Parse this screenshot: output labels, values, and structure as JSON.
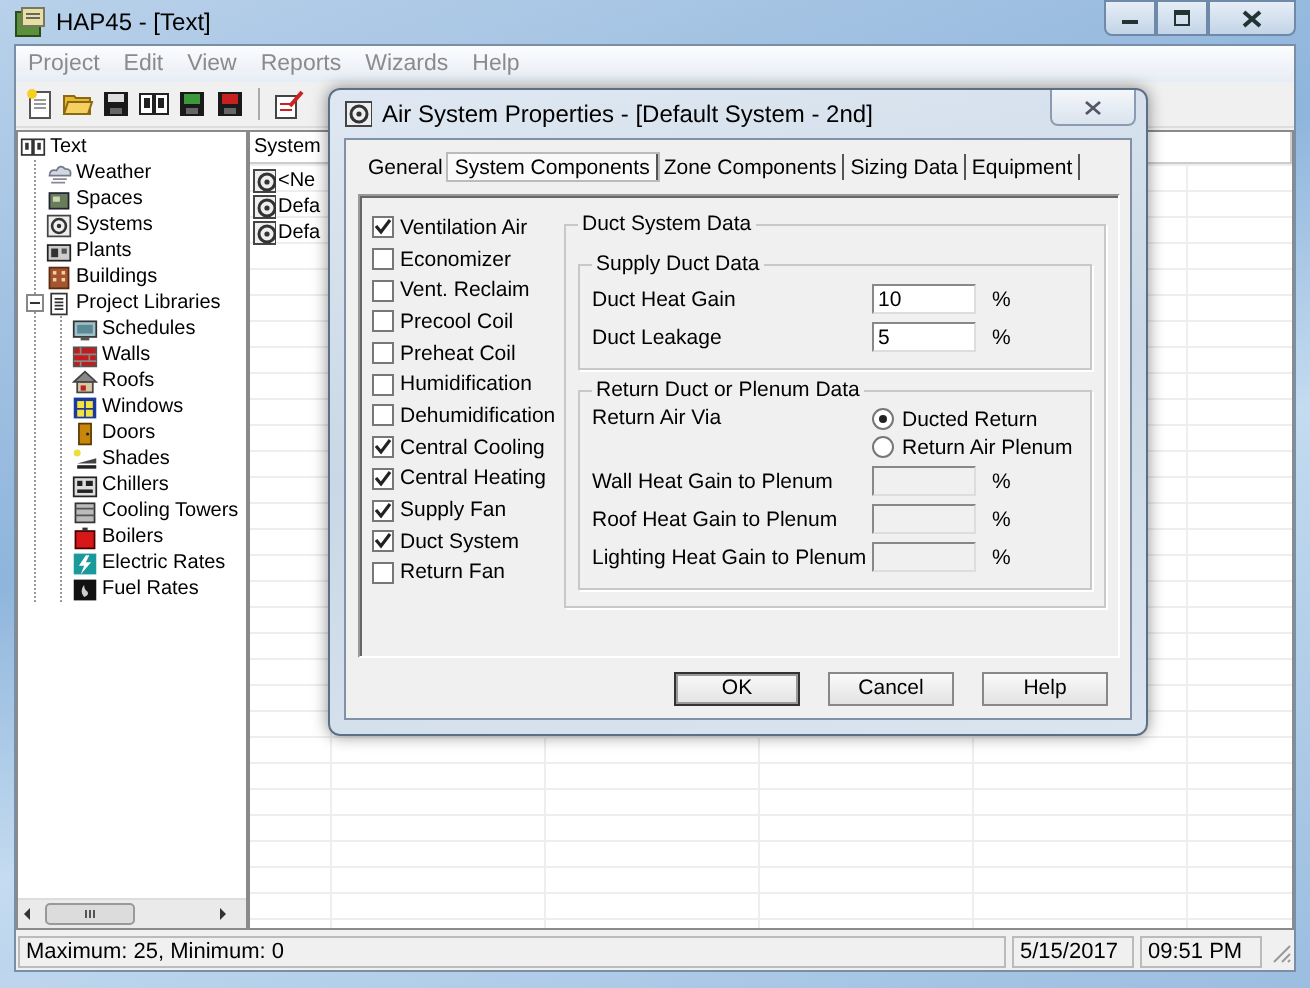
{
  "window": {
    "title": "HAP45 - [Text]"
  },
  "menu": [
    "Project",
    "Edit",
    "View",
    "Reports",
    "Wizards",
    "Help"
  ],
  "tree": [
    {
      "label": "Text",
      "children": [
        {
          "label": "Weather"
        },
        {
          "label": "Spaces"
        },
        {
          "label": "Systems"
        },
        {
          "label": "Plants"
        },
        {
          "label": "Buildings"
        },
        {
          "label": "Project Libraries",
          "expanded": true,
          "children": [
            {
              "label": "Schedules"
            },
            {
              "label": "Walls"
            },
            {
              "label": "Roofs"
            },
            {
              "label": "Windows"
            },
            {
              "label": "Doors"
            },
            {
              "label": "Shades"
            },
            {
              "label": "Chillers"
            },
            {
              "label": "Cooling Towers"
            },
            {
              "label": "Boilers"
            },
            {
              "label": "Electric Rates"
            },
            {
              "label": "Fuel Rates"
            }
          ]
        }
      ]
    }
  ],
  "list": {
    "columns": [
      "System"
    ],
    "rows": [
      "<Ne",
      "Defa",
      "Defa"
    ]
  },
  "dialog": {
    "title": "Air System Properties - [Default System - 2nd]",
    "tabs": [
      {
        "label": "General",
        "selected": false
      },
      {
        "label": "System Components",
        "selected": true
      },
      {
        "label": "Zone Components",
        "selected": false
      },
      {
        "label": "Sizing Data",
        "selected": false
      },
      {
        "label": "Equipment",
        "selected": false
      }
    ],
    "components": [
      {
        "label": "Ventilation Air",
        "checked": true
      },
      {
        "label": "Economizer",
        "checked": false
      },
      {
        "label": "Vent. Reclaim",
        "checked": false
      },
      {
        "label": "Precool Coil",
        "checked": false
      },
      {
        "label": "Preheat Coil",
        "checked": false
      },
      {
        "label": "Humidification",
        "checked": false
      },
      {
        "label": "Dehumidification",
        "checked": false
      },
      {
        "label": "Central Cooling",
        "checked": true
      },
      {
        "label": "Central Heating",
        "checked": true
      },
      {
        "label": "Supply Fan",
        "checked": true
      },
      {
        "label": "Duct System",
        "checked": true
      },
      {
        "label": "Return Fan",
        "checked": false
      }
    ],
    "duct_group": {
      "title": "Duct System Data",
      "supply": {
        "title": "Supply Duct Data",
        "fields": [
          {
            "label": "Duct Heat Gain",
            "value": "10",
            "unit": "%",
            "disabled": false
          },
          {
            "label": "Duct Leakage",
            "value": "5",
            "unit": "%",
            "disabled": false
          }
        ]
      },
      "return": {
        "title": "Return Duct or Plenum Data",
        "via_label": "Return Air Via",
        "options": [
          {
            "label": "Ducted Return",
            "selected": true
          },
          {
            "label": "Return Air Plenum",
            "selected": false
          }
        ],
        "fields": [
          {
            "label": "Wall Heat Gain to Plenum",
            "unit": "%",
            "disabled": true
          },
          {
            "label": "Roof Heat Gain to Plenum",
            "unit": "%",
            "disabled": true
          },
          {
            "label": "Lighting Heat Gain to Plenum",
            "unit": "%",
            "disabled": true
          }
        ]
      }
    },
    "buttons": [
      {
        "label": "OK",
        "default": true
      },
      {
        "label": "Cancel",
        "default": false
      },
      {
        "label": "Help",
        "default": false
      }
    ]
  },
  "status_bar": {
    "message": "Maximum: 25, Minimum: 0",
    "date": "5/15/2017",
    "time": "09:51 PM"
  }
}
